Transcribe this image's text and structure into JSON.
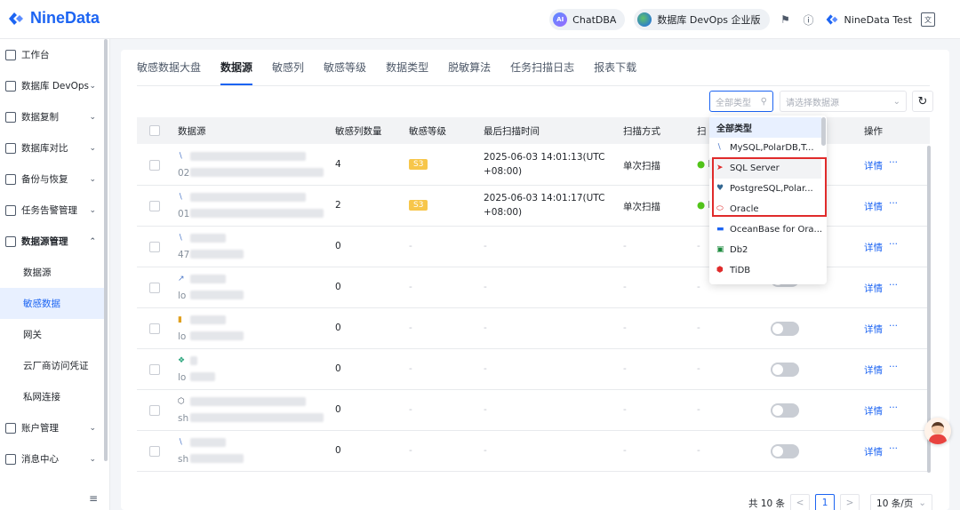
{
  "app": {
    "logo_text": "NineData",
    "brand_color": "#1c64f2"
  },
  "topbar": {
    "chatdba_label": "ChatDBA",
    "edition_label": "数据库 DevOps 企业版",
    "user_name": "NineData Test"
  },
  "sidebar": {
    "items": [
      {
        "label": "工作台",
        "icon": "home-icon",
        "expandable": false
      },
      {
        "label": "数据库 DevOps",
        "icon": "devops-icon",
        "expandable": true
      },
      {
        "label": "数据复制",
        "icon": "replication-icon",
        "expandable": true
      },
      {
        "label": "数据库对比",
        "icon": "compare-icon",
        "expandable": true
      },
      {
        "label": "备份与恢复",
        "icon": "backup-icon",
        "expandable": true
      },
      {
        "label": "任务告警管理",
        "icon": "alarm-icon",
        "expandable": true
      },
      {
        "label": "数据源管理",
        "icon": "datasource-icon",
        "expandable": true,
        "expanded": true
      }
    ],
    "subitems": [
      {
        "label": "数据源",
        "active": false
      },
      {
        "label": "敏感数据",
        "active": true
      },
      {
        "label": "网关",
        "active": false
      },
      {
        "label": "云厂商访问凭证",
        "active": false
      },
      {
        "label": "私网连接",
        "active": false
      }
    ],
    "bottom_items": [
      {
        "label": "账户管理",
        "icon": "account-icon",
        "expandable": true
      },
      {
        "label": "消息中心",
        "icon": "mail-icon",
        "expandable": true
      }
    ]
  },
  "tabs": [
    "敏感数据大盘",
    "数据源",
    "敏感列",
    "敏感等级",
    "数据类型",
    "脱敏算法",
    "任务扫描日志",
    "报表下载"
  ],
  "active_tab": "数据源",
  "filters": {
    "type_placeholder": "全部类型",
    "source_placeholder": "请选择数据源"
  },
  "table": {
    "columns": [
      "数据源",
      "敏感列数量",
      "敏感等级",
      "最后扫描时间",
      "扫描方式",
      "扫",
      "操作"
    ],
    "rows": [
      {
        "count": "4",
        "level": "S3",
        "scan_time_1": "2025-06-03 14:01:13(UTC",
        "scan_time_2": "+08:00)",
        "scan_mode": "单次扫描",
        "status": "E",
        "src_prefix": "02",
        "detail": "详情",
        "more": "···"
      },
      {
        "count": "2",
        "level": "S3",
        "scan_time_1": "2025-06-03 14:01:17(UTC",
        "scan_time_2": "+08:00)",
        "scan_mode": "单次扫描",
        "status": "E",
        "src_prefix": "01",
        "detail": "详情",
        "more": "···"
      },
      {
        "count": "0",
        "level": "-",
        "scan_time_1": "-",
        "scan_time_2": "",
        "scan_mode": "-",
        "status": "-",
        "src_prefix": "47",
        "detail": "详情",
        "more": "···"
      },
      {
        "count": "0",
        "level": "-",
        "scan_time_1": "-",
        "scan_time_2": "",
        "scan_mode": "-",
        "status": "-",
        "src_prefix": "lo",
        "detail": "详情",
        "more": "···"
      },
      {
        "count": "0",
        "level": "-",
        "scan_time_1": "-",
        "scan_time_2": "",
        "scan_mode": "-",
        "status": "-",
        "src_prefix": "lo",
        "detail": "详情",
        "more": "···"
      },
      {
        "count": "0",
        "level": "-",
        "scan_time_1": "-",
        "scan_time_2": "",
        "scan_mode": "-",
        "status": "-",
        "src_prefix": "lo",
        "detail": "详情",
        "more": "···"
      },
      {
        "count": "0",
        "level": "-",
        "scan_time_1": "-",
        "scan_time_2": "",
        "scan_mode": "-",
        "status": "-",
        "src_prefix": "sh",
        "detail": "详情",
        "more": "···"
      },
      {
        "count": "0",
        "level": "-",
        "scan_time_1": "-",
        "scan_time_2": "",
        "scan_mode": "-",
        "status": "-",
        "src_prefix": "sh",
        "detail": "详情",
        "more": "···"
      }
    ]
  },
  "pagination": {
    "total": "共 10 条",
    "current_page": "1",
    "page_size": "10 条/页",
    "prev": "<",
    "next": ">"
  },
  "dropdown": {
    "items": [
      {
        "label": "全部类型",
        "icon": "",
        "selected": true
      },
      {
        "label": "MySQL,PolarDB,T...",
        "icon": "mysql-icon"
      },
      {
        "label": "SQL Server",
        "icon": "sqlserver-icon",
        "highlighted": true
      },
      {
        "label": "PostgreSQL,Polar...",
        "icon": "postgresql-icon"
      },
      {
        "label": "Oracle",
        "icon": "oracle-icon"
      },
      {
        "label": "OceanBase for Ora...",
        "icon": "oceanbase-icon"
      },
      {
        "label": "Db2",
        "icon": "db2-icon"
      },
      {
        "label": "TiDB",
        "icon": "tidb-icon"
      }
    ],
    "highlight_color": "#e02b2b"
  }
}
